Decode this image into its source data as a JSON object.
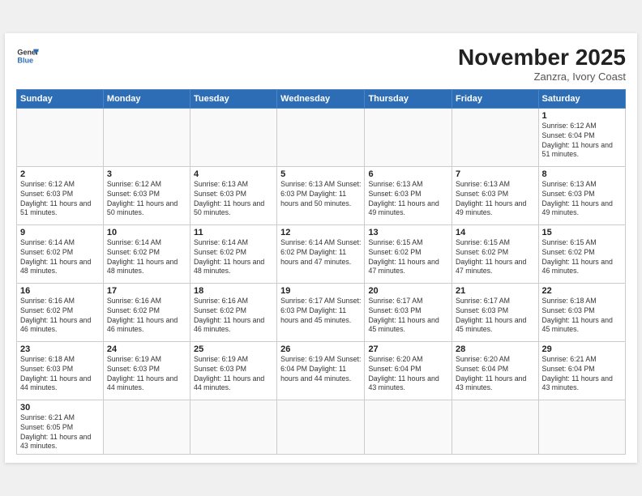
{
  "header": {
    "logo_general": "General",
    "logo_blue": "Blue",
    "month_title": "November 2025",
    "location": "Zanzra, Ivory Coast"
  },
  "days_of_week": [
    "Sunday",
    "Monday",
    "Tuesday",
    "Wednesday",
    "Thursday",
    "Friday",
    "Saturday"
  ],
  "weeks": [
    [
      {
        "day": "",
        "info": ""
      },
      {
        "day": "",
        "info": ""
      },
      {
        "day": "",
        "info": ""
      },
      {
        "day": "",
        "info": ""
      },
      {
        "day": "",
        "info": ""
      },
      {
        "day": "",
        "info": ""
      },
      {
        "day": "1",
        "info": "Sunrise: 6:12 AM\nSunset: 6:04 PM\nDaylight: 11 hours\nand 51 minutes."
      }
    ],
    [
      {
        "day": "2",
        "info": "Sunrise: 6:12 AM\nSunset: 6:03 PM\nDaylight: 11 hours\nand 51 minutes."
      },
      {
        "day": "3",
        "info": "Sunrise: 6:12 AM\nSunset: 6:03 PM\nDaylight: 11 hours\nand 50 minutes."
      },
      {
        "day": "4",
        "info": "Sunrise: 6:13 AM\nSunset: 6:03 PM\nDaylight: 11 hours\nand 50 minutes."
      },
      {
        "day": "5",
        "info": "Sunrise: 6:13 AM\nSunset: 6:03 PM\nDaylight: 11 hours\nand 50 minutes."
      },
      {
        "day": "6",
        "info": "Sunrise: 6:13 AM\nSunset: 6:03 PM\nDaylight: 11 hours\nand 49 minutes."
      },
      {
        "day": "7",
        "info": "Sunrise: 6:13 AM\nSunset: 6:03 PM\nDaylight: 11 hours\nand 49 minutes."
      },
      {
        "day": "8",
        "info": "Sunrise: 6:13 AM\nSunset: 6:03 PM\nDaylight: 11 hours\nand 49 minutes."
      }
    ],
    [
      {
        "day": "9",
        "info": "Sunrise: 6:14 AM\nSunset: 6:02 PM\nDaylight: 11 hours\nand 48 minutes."
      },
      {
        "day": "10",
        "info": "Sunrise: 6:14 AM\nSunset: 6:02 PM\nDaylight: 11 hours\nand 48 minutes."
      },
      {
        "day": "11",
        "info": "Sunrise: 6:14 AM\nSunset: 6:02 PM\nDaylight: 11 hours\nand 48 minutes."
      },
      {
        "day": "12",
        "info": "Sunrise: 6:14 AM\nSunset: 6:02 PM\nDaylight: 11 hours\nand 47 minutes."
      },
      {
        "day": "13",
        "info": "Sunrise: 6:15 AM\nSunset: 6:02 PM\nDaylight: 11 hours\nand 47 minutes."
      },
      {
        "day": "14",
        "info": "Sunrise: 6:15 AM\nSunset: 6:02 PM\nDaylight: 11 hours\nand 47 minutes."
      },
      {
        "day": "15",
        "info": "Sunrise: 6:15 AM\nSunset: 6:02 PM\nDaylight: 11 hours\nand 46 minutes."
      }
    ],
    [
      {
        "day": "16",
        "info": "Sunrise: 6:16 AM\nSunset: 6:02 PM\nDaylight: 11 hours\nand 46 minutes."
      },
      {
        "day": "17",
        "info": "Sunrise: 6:16 AM\nSunset: 6:02 PM\nDaylight: 11 hours\nand 46 minutes."
      },
      {
        "day": "18",
        "info": "Sunrise: 6:16 AM\nSunset: 6:02 PM\nDaylight: 11 hours\nand 46 minutes."
      },
      {
        "day": "19",
        "info": "Sunrise: 6:17 AM\nSunset: 6:03 PM\nDaylight: 11 hours\nand 45 minutes."
      },
      {
        "day": "20",
        "info": "Sunrise: 6:17 AM\nSunset: 6:03 PM\nDaylight: 11 hours\nand 45 minutes."
      },
      {
        "day": "21",
        "info": "Sunrise: 6:17 AM\nSunset: 6:03 PM\nDaylight: 11 hours\nand 45 minutes."
      },
      {
        "day": "22",
        "info": "Sunrise: 6:18 AM\nSunset: 6:03 PM\nDaylight: 11 hours\nand 45 minutes."
      }
    ],
    [
      {
        "day": "23",
        "info": "Sunrise: 6:18 AM\nSunset: 6:03 PM\nDaylight: 11 hours\nand 44 minutes."
      },
      {
        "day": "24",
        "info": "Sunrise: 6:19 AM\nSunset: 6:03 PM\nDaylight: 11 hours\nand 44 minutes."
      },
      {
        "day": "25",
        "info": "Sunrise: 6:19 AM\nSunset: 6:03 PM\nDaylight: 11 hours\nand 44 minutes."
      },
      {
        "day": "26",
        "info": "Sunrise: 6:19 AM\nSunset: 6:04 PM\nDaylight: 11 hours\nand 44 minutes."
      },
      {
        "day": "27",
        "info": "Sunrise: 6:20 AM\nSunset: 6:04 PM\nDaylight: 11 hours\nand 43 minutes."
      },
      {
        "day": "28",
        "info": "Sunrise: 6:20 AM\nSunset: 6:04 PM\nDaylight: 11 hours\nand 43 minutes."
      },
      {
        "day": "29",
        "info": "Sunrise: 6:21 AM\nSunset: 6:04 PM\nDaylight: 11 hours\nand 43 minutes."
      }
    ],
    [
      {
        "day": "30",
        "info": "Sunrise: 6:21 AM\nSunset: 6:05 PM\nDaylight: 11 hours\nand 43 minutes."
      },
      {
        "day": "",
        "info": ""
      },
      {
        "day": "",
        "info": ""
      },
      {
        "day": "",
        "info": ""
      },
      {
        "day": "",
        "info": ""
      },
      {
        "day": "",
        "info": ""
      },
      {
        "day": "",
        "info": ""
      }
    ]
  ]
}
